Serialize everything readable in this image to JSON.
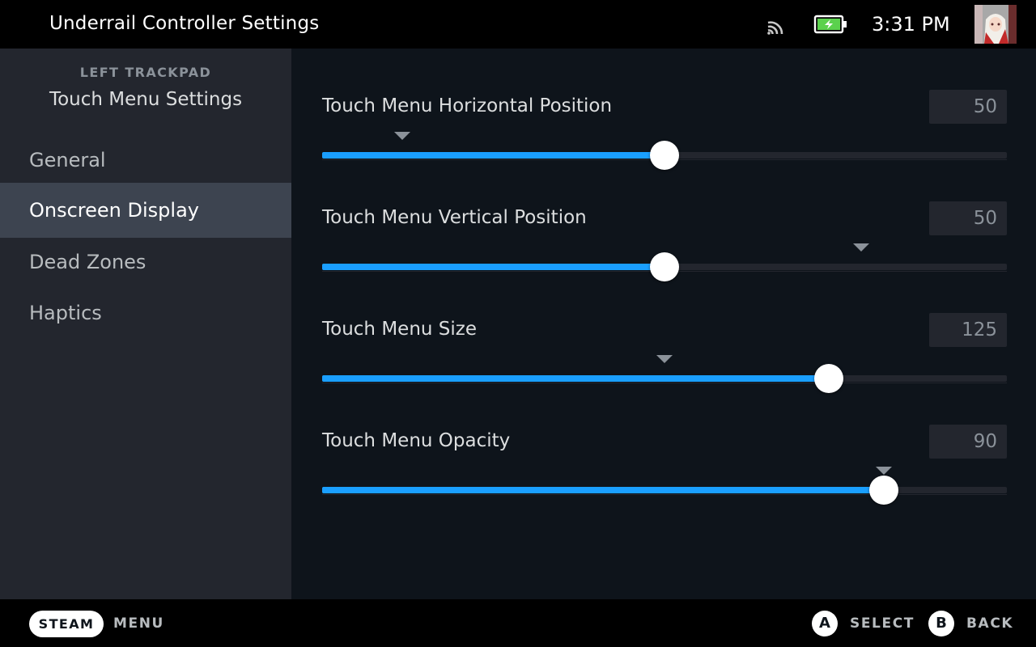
{
  "window": {
    "title": "Underrail Controller Settings"
  },
  "status": {
    "time": "3:31 PM",
    "cast_icon": "cast-icon",
    "battery_icon": "battery-charging-icon",
    "accent": "#1a9fff"
  },
  "sidebar": {
    "kicker": "LEFT TRACKPAD",
    "title": "Touch Menu Settings",
    "items": [
      {
        "label": "General",
        "active": false
      },
      {
        "label": "Onscreen Display",
        "active": true
      },
      {
        "label": "Dead Zones",
        "active": false
      },
      {
        "label": "Haptics",
        "active": false
      }
    ]
  },
  "settings": [
    {
      "label": "Touch Menu Horizontal Position",
      "value": "50",
      "fraction": 0.5,
      "default_fraction": 0.117
    },
    {
      "label": "Touch Menu Vertical Position",
      "value": "50",
      "fraction": 0.5,
      "default_fraction": 0.787
    },
    {
      "label": "Touch Menu Size",
      "value": "125",
      "fraction": 0.74,
      "default_fraction": 0.5
    },
    {
      "label": "Touch Menu Opacity",
      "value": "90",
      "fraction": 0.82,
      "default_fraction": 0.82
    }
  ],
  "footer": {
    "steam_label": "STEAM",
    "menu_label": "MENU",
    "a_glyph": "A",
    "select_label": "SELECT",
    "b_glyph": "B",
    "back_label": "BACK"
  }
}
